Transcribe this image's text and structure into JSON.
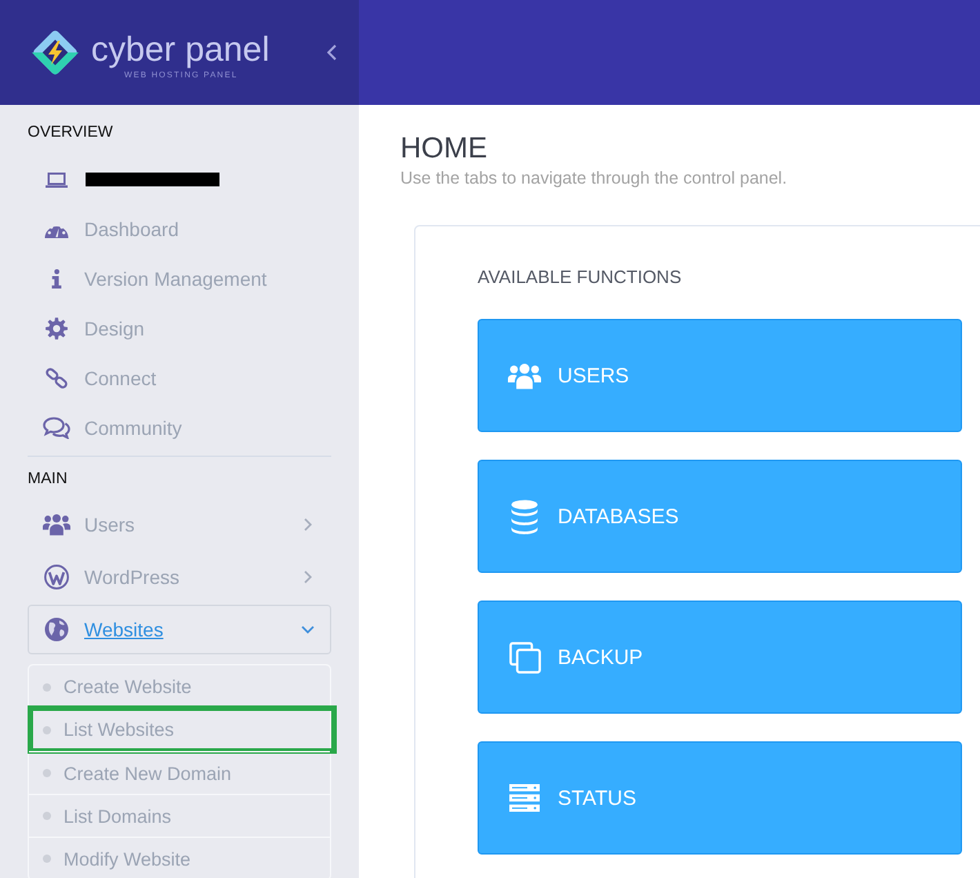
{
  "header": {
    "logo": {
      "name": "cyber panel",
      "tagline": "WEB HOSTING PANEL"
    }
  },
  "sidebar": {
    "sections": [
      {
        "title": "OVERVIEW",
        "items": [
          {
            "kind": "redacted"
          },
          {
            "kind": "link",
            "label": "Dashboard",
            "selected": false
          },
          {
            "kind": "link",
            "label": "Version Management",
            "selected": false
          },
          {
            "kind": "link",
            "label": "Design",
            "selected": false
          },
          {
            "kind": "link",
            "label": "Connect",
            "selected": false
          },
          {
            "kind": "link",
            "label": "Community",
            "selected": false
          }
        ]
      },
      {
        "title": "MAIN",
        "items": [
          {
            "kind": "menu",
            "label": "Users",
            "selected": false,
            "expanded": false
          },
          {
            "kind": "menu",
            "label": "WordPress",
            "selected": false,
            "expanded": false
          },
          {
            "kind": "menu",
            "label": "Websites",
            "selected": true,
            "expanded": true,
            "children": [
              {
                "label": "Create Website",
                "highlighted": false
              },
              {
                "label": "List Websites",
                "highlighted": true
              },
              {
                "label": "Create New Domain",
                "highlighted": false
              },
              {
                "label": "List Domains",
                "highlighted": false
              },
              {
                "label": "Modify Website",
                "highlighted": false
              }
            ]
          }
        ]
      }
    ]
  },
  "page": {
    "title": "HOME",
    "subtitle": "Use the tabs to navigate through the control panel.",
    "panel": {
      "heading": "AVAILABLE FUNCTIONS",
      "functions": [
        {
          "label": "USERS"
        },
        {
          "label": "DATABASES"
        },
        {
          "label": "BACKUP"
        },
        {
          "label": "STATUS"
        }
      ]
    }
  }
}
